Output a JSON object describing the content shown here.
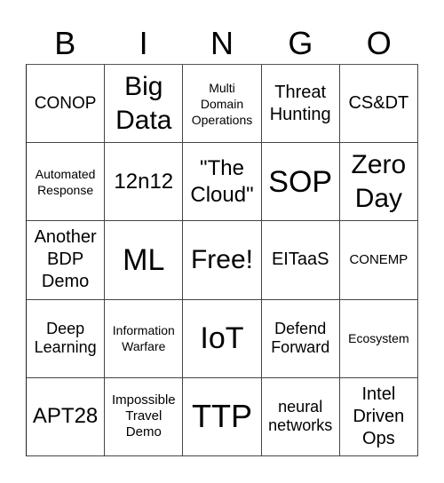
{
  "header": {
    "letters": [
      "B",
      "I",
      "N",
      "G",
      "O"
    ]
  },
  "cells": [
    {
      "text": "CONOP",
      "size": "s19"
    },
    {
      "text": "Big\nData",
      "size": "s30"
    },
    {
      "text": "Multi\nDomain\nOperations",
      "size": "s14"
    },
    {
      "text": "Threat\nHunting",
      "size": "s20"
    },
    {
      "text": "CS&DT",
      "size": "s20"
    },
    {
      "text": "Automated\nResponse",
      "size": "s14"
    },
    {
      "text": "12n12",
      "size": "s24"
    },
    {
      "text": "\"The\nCloud\"",
      "size": "s24"
    },
    {
      "text": "SOP",
      "size": "s34"
    },
    {
      "text": "Zero\nDay",
      "size": "s30"
    },
    {
      "text": "Another\nBDP\nDemo",
      "size": "s20"
    },
    {
      "text": "ML",
      "size": "s34"
    },
    {
      "text": "Free!",
      "size": "s30"
    },
    {
      "text": "EITaaS",
      "size": "s20"
    },
    {
      "text": "CONEMP",
      "size": "s15"
    },
    {
      "text": "Deep\nLearning",
      "size": "s18"
    },
    {
      "text": "Information\nWarfare",
      "size": "s14"
    },
    {
      "text": "IoT",
      "size": "s34"
    },
    {
      "text": "Defend\nForward",
      "size": "s18"
    },
    {
      "text": "Ecosystem",
      "size": "s14"
    },
    {
      "text": "APT28",
      "size": "s24"
    },
    {
      "text": "Impossible\nTravel\nDemo",
      "size": "s15"
    },
    {
      "text": "TTP",
      "size": "s36"
    },
    {
      "text": "neural\nnetworks",
      "size": "s18"
    },
    {
      "text": "Intel\nDriven\nOps",
      "size": "s20"
    }
  ]
}
